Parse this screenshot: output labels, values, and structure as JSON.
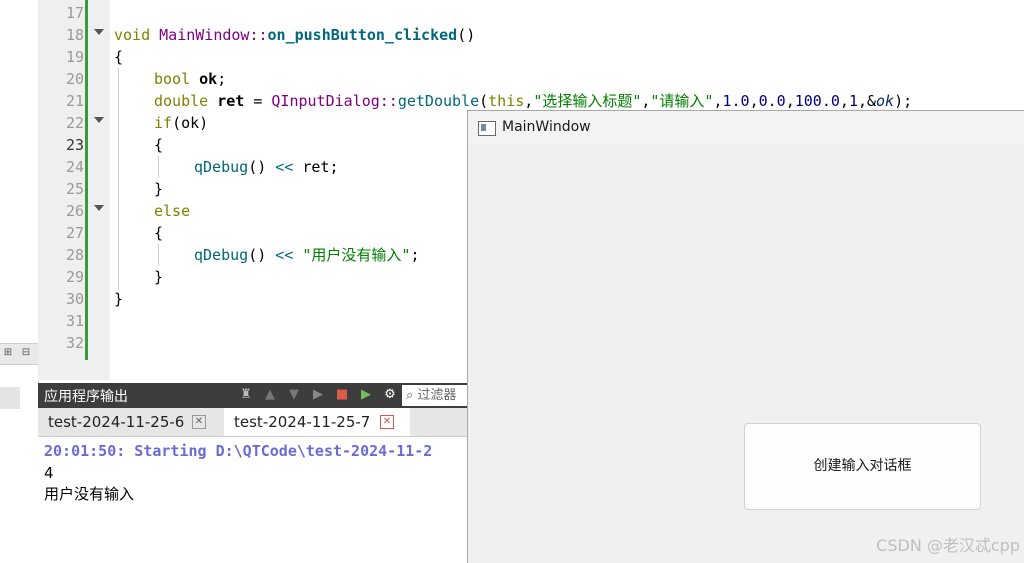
{
  "left_strip": {
    "btn1": "⊞",
    "btn2": "⊟"
  },
  "gutter": {
    "lines": [
      "17",
      "18",
      "19",
      "20",
      "21",
      "22",
      "23",
      "24",
      "25",
      "26",
      "27",
      "28",
      "29",
      "30",
      "31",
      "32"
    ]
  },
  "code": {
    "l18": {
      "ret": "void",
      "cls": "MainWindow",
      "sep": "::",
      "fn": "on_pushButton_clicked",
      "args": "()"
    },
    "l19": "{",
    "l20": {
      "type": "bool",
      "name": "ok",
      "end": ";"
    },
    "l21": {
      "type": "double",
      "name": "ret",
      "eq": " = ",
      "cls": "QInputDialog",
      "sep": "::",
      "fn": "getDouble",
      "open": "(",
      "this": "this",
      "c1": ",",
      "s1": "\"选择输入标题\"",
      "c2": ",",
      "s2": "\"请输入\"",
      "c3": ",",
      "n1": "1.0",
      "c4": ",",
      "n2": "0.0",
      "c5": ",",
      "n3": "100.0",
      "c6": ",",
      "n4": "1",
      "c7": ",&",
      "ok": "ok",
      "end": ");"
    },
    "l22": {
      "kw": "if",
      "rest": "(ok)"
    },
    "l23": "{",
    "l24": {
      "fn": "qDebug",
      "call": "()",
      "op": " << ",
      "var": "ret",
      "end": ";"
    },
    "l25": "}",
    "l26": {
      "kw": "else"
    },
    "l27": "{",
    "l28": {
      "fn": "qDebug",
      "call": "()",
      "op": " << ",
      "str": "\"用户没有输入\"",
      "end": ";"
    },
    "l29": "}",
    "l30": "}"
  },
  "output": {
    "title": "应用程序输出",
    "filter_placeholder": "过滤器",
    "tabs": [
      {
        "label": "test-2024-11-25-6"
      },
      {
        "label": "test-2024-11-25-7"
      }
    ],
    "lines": [
      "20:01:50: Starting D:\\QTCode\\test-2024-11-2",
      "4",
      "用户没有输入"
    ]
  },
  "main_window": {
    "title": "MainWindow",
    "button_label": "创建输入对话框"
  },
  "watermark": "CSDN @老汉忒cpp"
}
